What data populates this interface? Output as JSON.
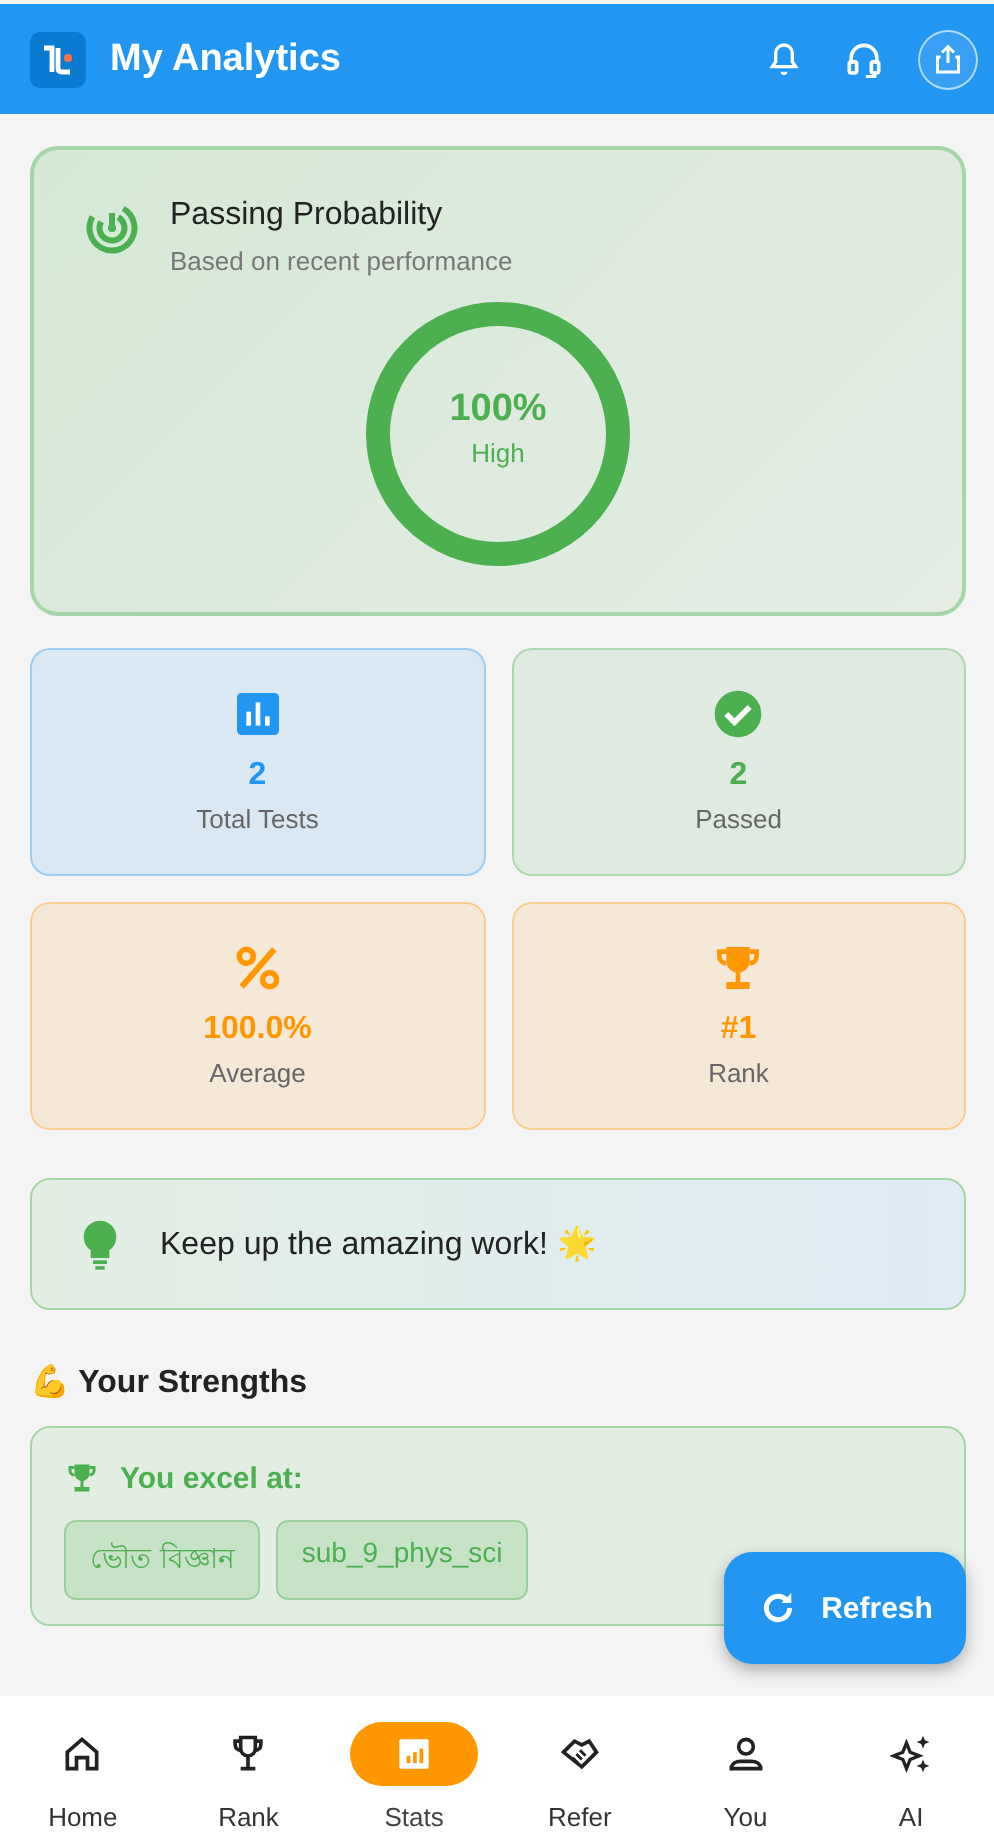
{
  "app_bar": {
    "title": "My Analytics"
  },
  "probability": {
    "title": "Passing Probability",
    "subtitle": "Based on recent performance",
    "value": "100%",
    "label": "High"
  },
  "stats": [
    {
      "kind": "tests",
      "value": "2",
      "label": "Total Tests",
      "color": "#2196f3"
    },
    {
      "kind": "passed",
      "value": "2",
      "label": "Passed",
      "color": "#4caf50"
    },
    {
      "kind": "average",
      "value": "100.0%",
      "label": "Average",
      "color": "#ff9800"
    },
    {
      "kind": "rank",
      "value": "#1",
      "label": "Rank",
      "color": "#ff9800"
    }
  ],
  "tip": {
    "text": "Keep up the amazing work! 🌟"
  },
  "strengths": {
    "heading": "💪 Your Strengths",
    "label": "You excel at:",
    "tags": [
      "ভৌত বিজ্ঞান",
      "sub_9_phys_sci"
    ]
  },
  "fab": {
    "label": "Refresh"
  },
  "nav": [
    {
      "kind": "home",
      "label": "Home",
      "selected": false
    },
    {
      "kind": "rank",
      "label": "Rank",
      "selected": false
    },
    {
      "kind": "stats",
      "label": "Stats",
      "selected": true
    },
    {
      "kind": "refer",
      "label": "Refer",
      "selected": false
    },
    {
      "kind": "you",
      "label": "You",
      "selected": false
    },
    {
      "kind": "ai",
      "label": "AI",
      "selected": false
    }
  ]
}
